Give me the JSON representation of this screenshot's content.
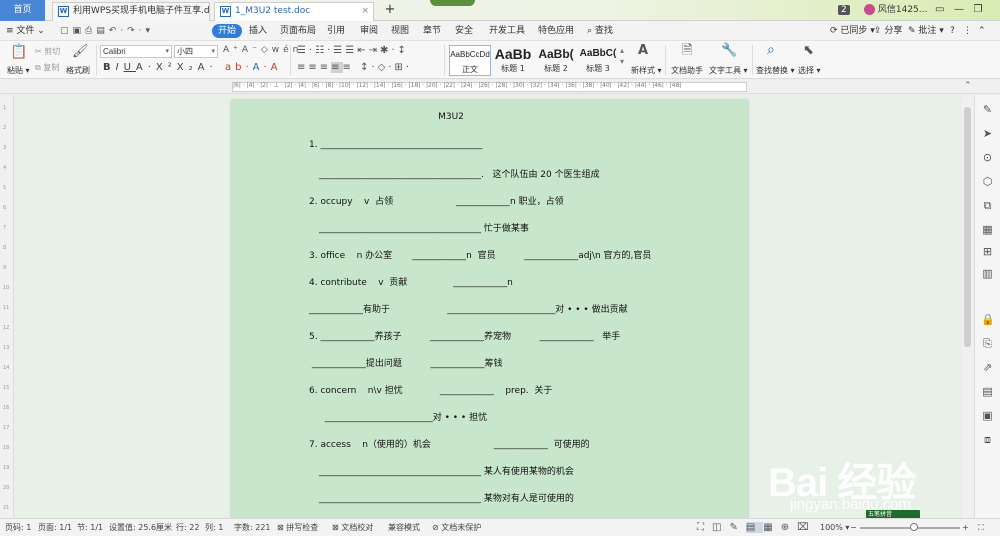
{
  "tabs": {
    "home": "首页",
    "doc1": "利用WPS买现手机电脑子件互享.doc",
    "doc2": "1_M3U2 test.doc",
    "new_tab": "+",
    "window_count": "2",
    "user": "风信1425..."
  },
  "menu": {
    "file": "文件",
    "items": [
      "开始",
      "插入",
      "页面布局",
      "引用",
      "审阅",
      "视图",
      "章节",
      "安全",
      "开发工具",
      "特色应用"
    ],
    "search": "查找",
    "sync": "已同步",
    "share": "分享",
    "comment": "批注"
  },
  "ribbon": {
    "paste": "粘贴",
    "cut": "剪切",
    "copy": "复制",
    "format_painter": "格式刷",
    "font": "Calibri",
    "size": "小四",
    "styles": [
      {
        "sample": "AaBbCcDd",
        "label": "正文"
      },
      {
        "sample": "AaBb",
        "label": "标题 1"
      },
      {
        "sample": "AaBb(",
        "label": "标题 2"
      },
      {
        "sample": "AaBbC(",
        "label": "标题 3"
      }
    ],
    "new_style": "新样式",
    "doc_assistant": "文档助手",
    "text_tools": "文字工具",
    "find_replace": "查找替换",
    "select": "选择"
  },
  "document": {
    "title": "M3U2",
    "lines": [
      "1. ____________________________________",
      "____________________________________.   这个队伍由 20 个医生组成",
      "2. occupy    v  占领                      ____________n 职业，占领",
      "____________________________________ 忙于做某事",
      "3. office    n 办公室       ____________n  官员          ____________adj\\n 官方的,官员",
      "4. contribute    v  贡献                ____________n",
      "____________有助于                    ________________________对 • • • 做出贡献",
      "5. ____________养孩子          ____________养宠物          ____________   举手",
      " ____________提出问题          ____________筹钱",
      "6. concern    n\\v 担忧             ____________    prep.  关于",
      "  ________________________对 • • • 担忧",
      "7. access    n（使用的）机会                      ____________  可使用的",
      "____________________________________ 某人有使用某物的机会",
      "____________________________________ 某物对有人是可使用的"
    ]
  },
  "status": {
    "page": "页码: 1",
    "pages": "页面: 1/1",
    "section": "节: 1/1",
    "setting": "设置值: 25.6厘米",
    "row": "行: 22",
    "col": "列: 1",
    "words": "字数: 221",
    "spell": "拼写检查",
    "proof": "文档校对",
    "compat": "兼容模式",
    "protect": "文档未保护",
    "zoom": "100%"
  },
  "watermark": {
    "logo": "Bai 经验",
    "url": "jingyan.baidu.com"
  },
  "ime": "五笔拼音"
}
